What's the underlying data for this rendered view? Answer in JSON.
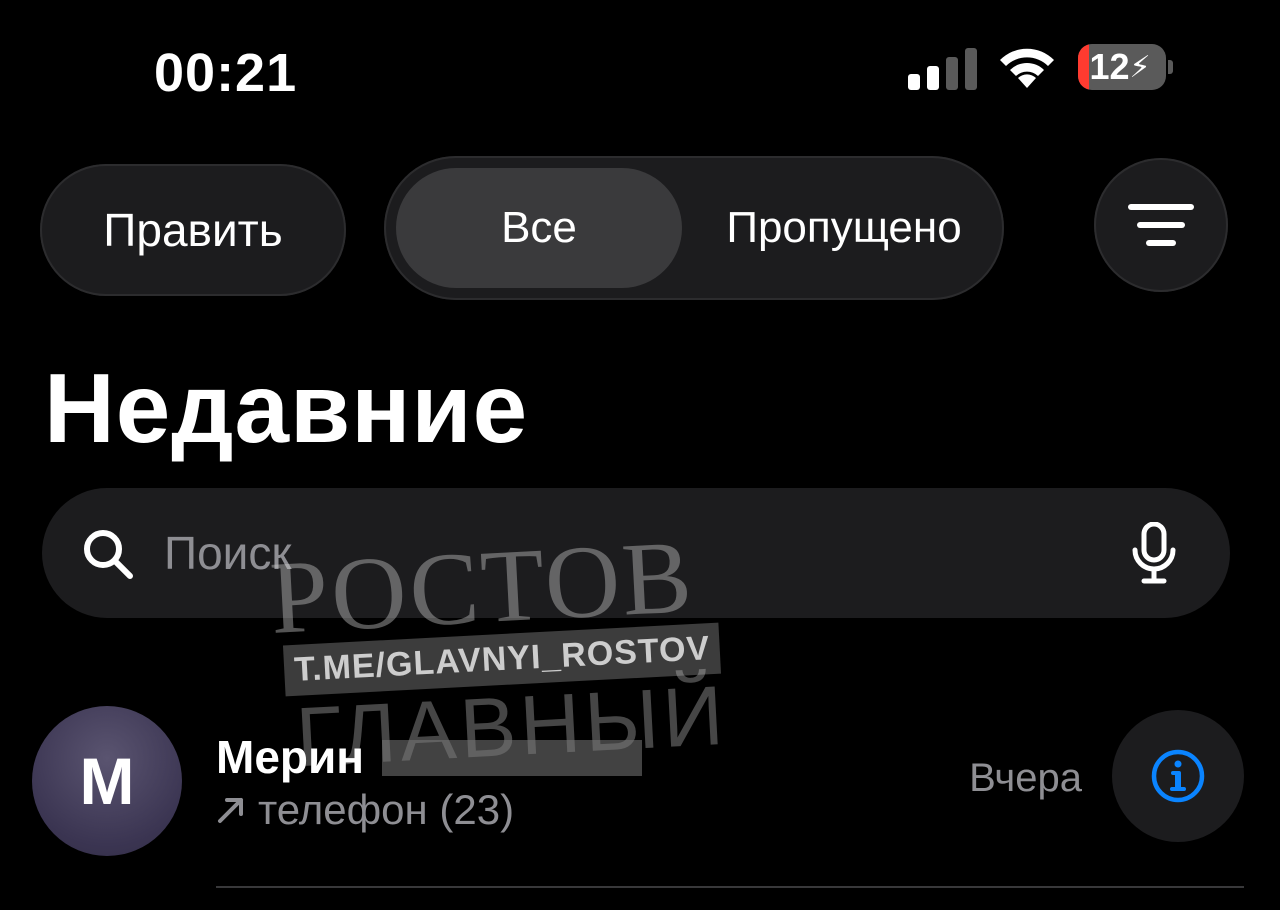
{
  "status_bar": {
    "time": "00:21",
    "battery_level": "12",
    "battery_fraction": 0.12,
    "icons": [
      "cellular-signal-icon",
      "wifi-icon",
      "battery-charging-icon"
    ]
  },
  "toolbar": {
    "edit_label": "Править",
    "segments": [
      {
        "label": "Все",
        "selected": true
      },
      {
        "label": "Пропущено",
        "selected": false
      }
    ],
    "filter_icon": "filter-lines-icon"
  },
  "page": {
    "title": "Недавние"
  },
  "search": {
    "placeholder": "Поиск",
    "value": "",
    "icons": [
      "search-icon",
      "microphone-icon"
    ]
  },
  "watermark": {
    "line1": "РОСТОВ",
    "line2": "T.ME/GLAVNYI_ROSTOV",
    "line3": "ГЛАВНЫЙ"
  },
  "recents": [
    {
      "avatar_initial": "M",
      "name": "Мерин",
      "detail": "телефон (23)",
      "time": "Вчера",
      "direction_icon": "outgoing-arrow-icon",
      "action_icon": "info-icon"
    }
  ],
  "colors": {
    "background": "#000000",
    "surface": "#1c1c1e",
    "selected_segment": "#3a3a3c",
    "secondary_text": "#8e8e93",
    "accent_blue": "#0a84ff",
    "battery_red": "#ff3b30",
    "avatar_purple": "#3b3552"
  }
}
